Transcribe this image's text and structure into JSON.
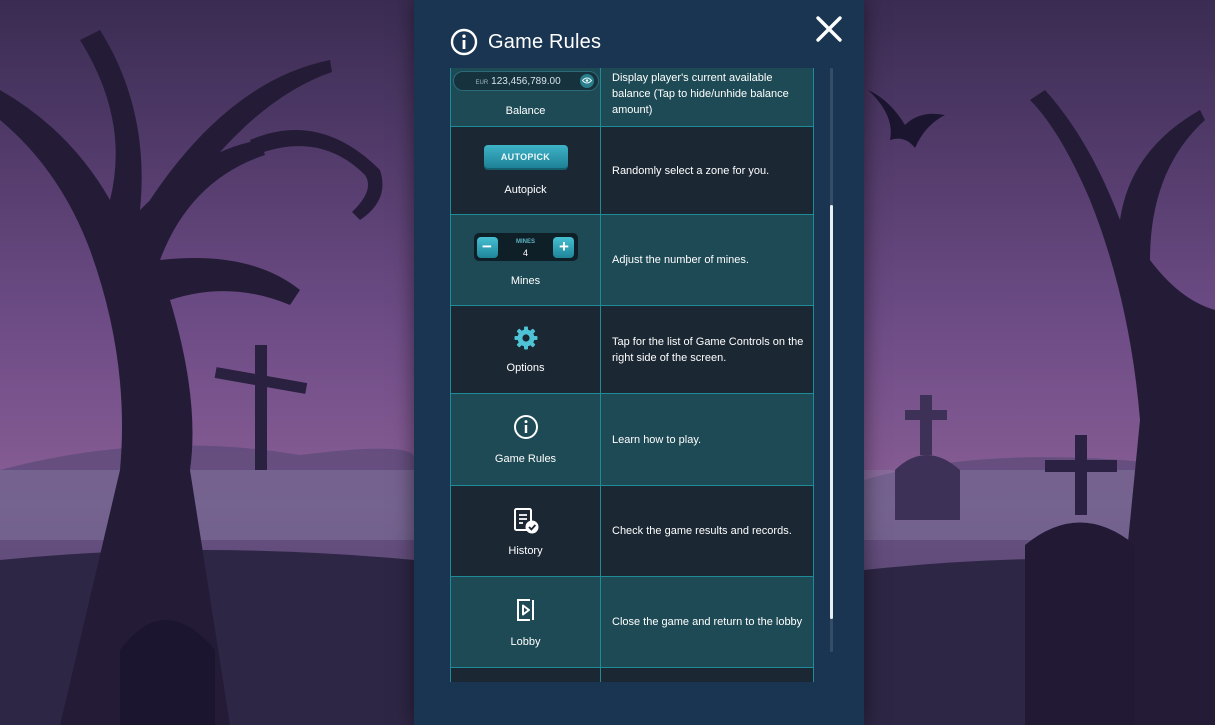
{
  "modal": {
    "title": "Game Rules",
    "icons": {
      "header": "info-circle-icon",
      "close": "close-x-icon"
    }
  },
  "rows": [
    {
      "label": "Balance",
      "description": "Display player's current available balance (Tap to hide/unhide balance amount)",
      "icon": "balance-widget",
      "currency": "EUR",
      "amount": "123,456,789.00"
    },
    {
      "label": "Autopick",
      "description": "Randomly select a zone for you.",
      "icon": "autopick-button",
      "button_text": "AUTOPICK"
    },
    {
      "label": "Mines",
      "description": "Adjust the number of mines.",
      "icon": "mines-stepper",
      "stepper_label": "MINES",
      "stepper_value": "4",
      "minus": "−",
      "plus": "+"
    },
    {
      "label": "Options",
      "description": "Tap for the list of Game Controls on the right side of the screen.",
      "icon": "gear-icon"
    },
    {
      "label": "Game Rules",
      "description": "Learn how to play.",
      "icon": "info-circle-icon"
    },
    {
      "label": "History",
      "description": "Check the game results and records.",
      "icon": "history-icon"
    },
    {
      "label": "Lobby",
      "description": "Close the game and return to the lobby",
      "icon": "exit-icon"
    }
  ],
  "colors": {
    "modal_bg": "#1a3552",
    "row_teal": "#1e4a55",
    "row_dark": "#1b2733",
    "border": "#1f8b98",
    "accent": "#3fb3c7"
  }
}
